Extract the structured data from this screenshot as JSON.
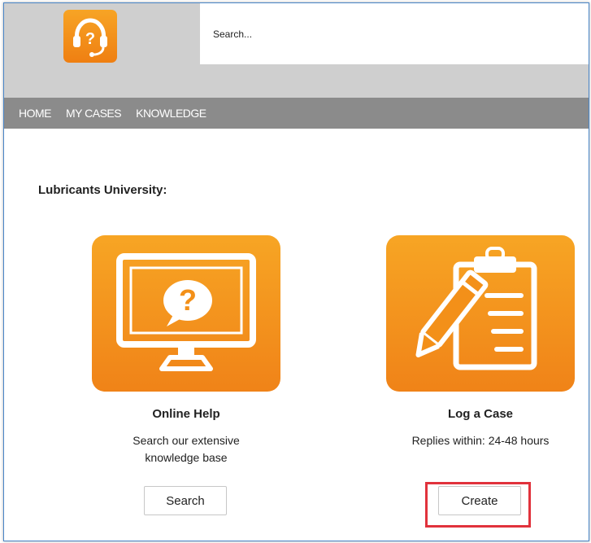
{
  "header": {
    "logo_icon": "headset-question-icon",
    "search": {
      "placeholder": "Search..."
    }
  },
  "nav": {
    "items": [
      {
        "label": "HOME"
      },
      {
        "label": "MY CASES"
      },
      {
        "label": "KNOWLEDGE"
      }
    ]
  },
  "main": {
    "section_title": "Lubricants University:",
    "cards": [
      {
        "icon": "monitor-question-icon",
        "title": "Online Help",
        "desc_line1": "Search our extensive",
        "desc_line2": "knowledge base",
        "button_label": "Search"
      },
      {
        "icon": "clipboard-pencil-icon",
        "title": "Log a Case",
        "desc_line1": "Replies within: 24-48 hours",
        "button_label": "Create"
      }
    ]
  },
  "colors": {
    "accent_orange": "#f39019",
    "nav_gray": "#8b8b8b",
    "highlight_red": "#e1323c"
  }
}
